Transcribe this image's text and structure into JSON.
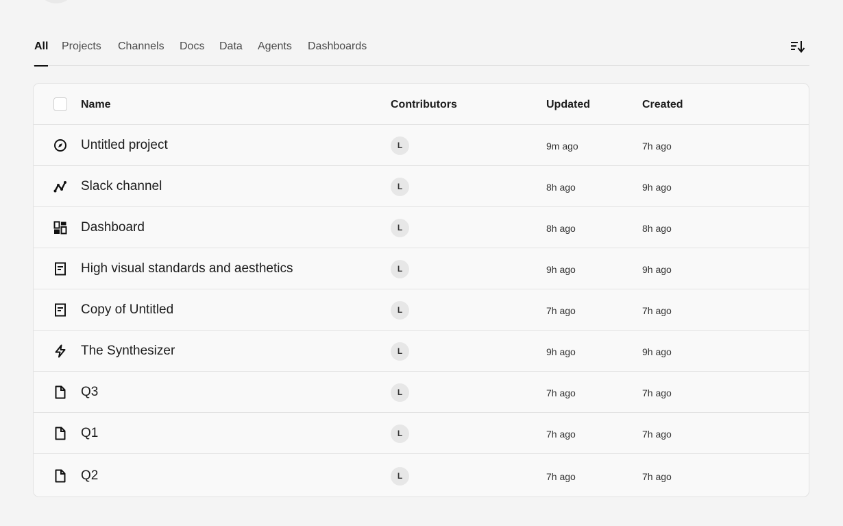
{
  "tabs": [
    {
      "label": "All",
      "active": true
    },
    {
      "label": "Projects",
      "active": false
    },
    {
      "label": "Channels",
      "active": false
    },
    {
      "label": "Docs",
      "active": false
    },
    {
      "label": "Data",
      "active": false
    },
    {
      "label": "Agents",
      "active": false
    },
    {
      "label": "Dashboards",
      "active": false
    }
  ],
  "sort_icon": "sort-descending-icon",
  "table": {
    "columns": {
      "name": "Name",
      "contributors": "Contributors",
      "updated": "Updated",
      "created": "Created"
    },
    "rows": [
      {
        "icon": "compass-icon",
        "name": "Untitled project",
        "contributor": "L",
        "updated": "9m ago",
        "created": "7h ago"
      },
      {
        "icon": "channel-icon",
        "name": "Slack channel",
        "contributor": "L",
        "updated": "8h ago",
        "created": "9h ago"
      },
      {
        "icon": "dashboard-icon",
        "name": "Dashboard",
        "contributor": "L",
        "updated": "8h ago",
        "created": "8h ago"
      },
      {
        "icon": "doc-icon",
        "name": "High visual standards and aesthetics",
        "contributor": "L",
        "updated": "9h ago",
        "created": "9h ago"
      },
      {
        "icon": "doc-icon",
        "name": "Copy of Untitled",
        "contributor": "L",
        "updated": "7h ago",
        "created": "7h ago"
      },
      {
        "icon": "bolt-icon",
        "name": "The Synthesizer",
        "contributor": "L",
        "updated": "9h ago",
        "created": "9h ago"
      },
      {
        "icon": "file-icon",
        "name": "Q3",
        "contributor": "L",
        "updated": "7h ago",
        "created": "7h ago"
      },
      {
        "icon": "file-icon",
        "name": "Q1",
        "contributor": "L",
        "updated": "7h ago",
        "created": "7h ago"
      },
      {
        "icon": "file-icon",
        "name": "Q2",
        "contributor": "L",
        "updated": "7h ago",
        "created": "7h ago"
      }
    ]
  }
}
